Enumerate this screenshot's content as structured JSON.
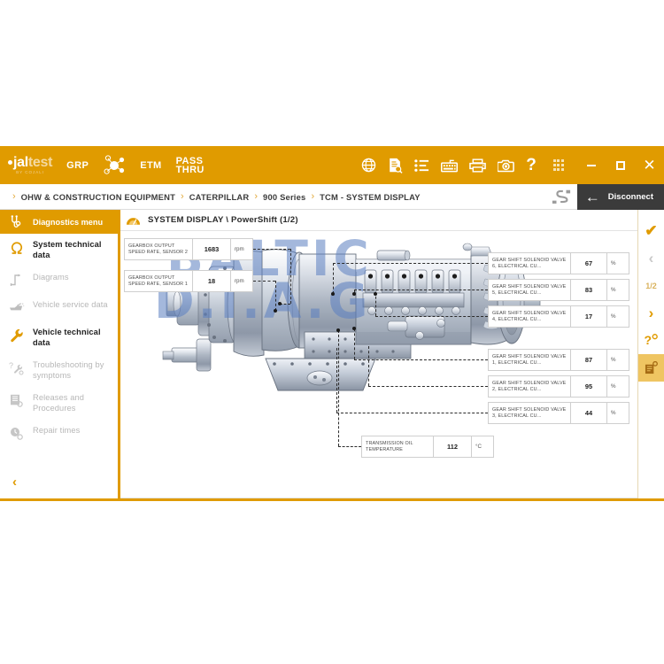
{
  "brand": {
    "logo_main": "jaltest",
    "logo_main_light": "test",
    "logo_main_bold": "jal",
    "logo_sub": "BY COJALI",
    "accent": "#e09b00",
    "dark": "#3b3b3b"
  },
  "topbar": {
    "grp_label": "GRP",
    "etm_label": "ETM",
    "pass_label": "PASS",
    "thru_label": "THRU",
    "tools": [
      {
        "name": "globe-icon",
        "title": "Language"
      },
      {
        "name": "document-search-icon",
        "title": "Reports"
      },
      {
        "name": "list-icon",
        "title": "List"
      },
      {
        "name": "keyboard-icon",
        "title": "Keyboard"
      },
      {
        "name": "printer-icon",
        "title": "Print"
      },
      {
        "name": "camera-icon",
        "title": "Screenshot"
      },
      {
        "name": "help-icon",
        "title": "Help"
      }
    ],
    "apps_icon": "grid-icon",
    "window": {
      "minimize": "minimize-icon",
      "maximize": "maximize-icon",
      "close": "close-icon"
    }
  },
  "breadcrumb": {
    "items": [
      "OHW & CONSTRUCTION EQUIPMENT",
      "CATERPILLAR",
      "900 Series",
      "TCM - SYSTEM DISPLAY"
    ],
    "separator": "›",
    "scan_icon": "obd-connector-icon",
    "disconnect_label": "Disconnect",
    "disconnect_arrow": "←"
  },
  "sidebar": {
    "header": {
      "label": "Diagnostics menu",
      "icon": "diagnostics-menu-icon"
    },
    "items": [
      {
        "label": "System technical data",
        "icon": "omega-icon",
        "state": "active"
      },
      {
        "label": "Diagrams",
        "icon": "diagram-icon",
        "state": "disabled"
      },
      {
        "label": "Vehicle service data",
        "icon": "oil-can-icon",
        "state": "disabled"
      },
      {
        "label": "Vehicle technical data",
        "icon": "wrench-icon",
        "state": "active"
      },
      {
        "label": "Troubleshooting by symptoms",
        "icon": "troubleshoot-icon",
        "state": "disabled"
      },
      {
        "label": "Releases and Procedures",
        "icon": "releases-icon",
        "state": "disabled"
      },
      {
        "label": "Repair times",
        "icon": "clock-gear-icon",
        "state": "disabled"
      }
    ],
    "collapse_icon": "‹"
  },
  "content": {
    "title": "SYSTEM DISPLAY \\ PowerShift (1/2)",
    "title_icon": "system-display-icon",
    "watermark_line1": "BALTIC",
    "watermark_line2": "D.I.A.G",
    "diagram_name": "powershift-transmission-diagram"
  },
  "measurements": {
    "left": [
      {
        "label": "GEARBOX OUTPUT SPEED RATE, SENSOR 2",
        "value": "1683",
        "unit": "rpm"
      },
      {
        "label": "GEARBOX OUTPUT SPEED RATE, SENSOR 1",
        "value": "18",
        "unit": "rpm"
      }
    ],
    "right": [
      {
        "label": "GEAR SHIFT SOLENOID VALVE 6, ELECTRICAL CU...",
        "value": "67",
        "unit": "%"
      },
      {
        "label": "GEAR SHIFT SOLENOID VALVE 5, ELECTRICAL CU...",
        "value": "83",
        "unit": "%"
      },
      {
        "label": "GEAR SHIFT SOLENOID VALVE 4, ELECTRICAL CU...",
        "value": "17",
        "unit": "%"
      },
      {
        "label": "GEAR SHIFT SOLENOID VALVE 1, ELECTRICAL CU...",
        "value": "87",
        "unit": "%"
      },
      {
        "label": "GEAR SHIFT SOLENOID VALVE 2, ELECTRICAL CU...",
        "value": "95",
        "unit": "%"
      },
      {
        "label": "GEAR SHIFT SOLENOID VALVE 3, ELECTRICAL CU...",
        "value": "44",
        "unit": "%"
      }
    ],
    "bottom": [
      {
        "label": "TRANSMISSION OIL TEMPERATURE",
        "value": "112",
        "unit": "°C"
      }
    ]
  },
  "rail": {
    "confirm": "✔",
    "prev": "‹",
    "page": "1/2",
    "next": "›",
    "help": "?",
    "report": "report-icon"
  }
}
